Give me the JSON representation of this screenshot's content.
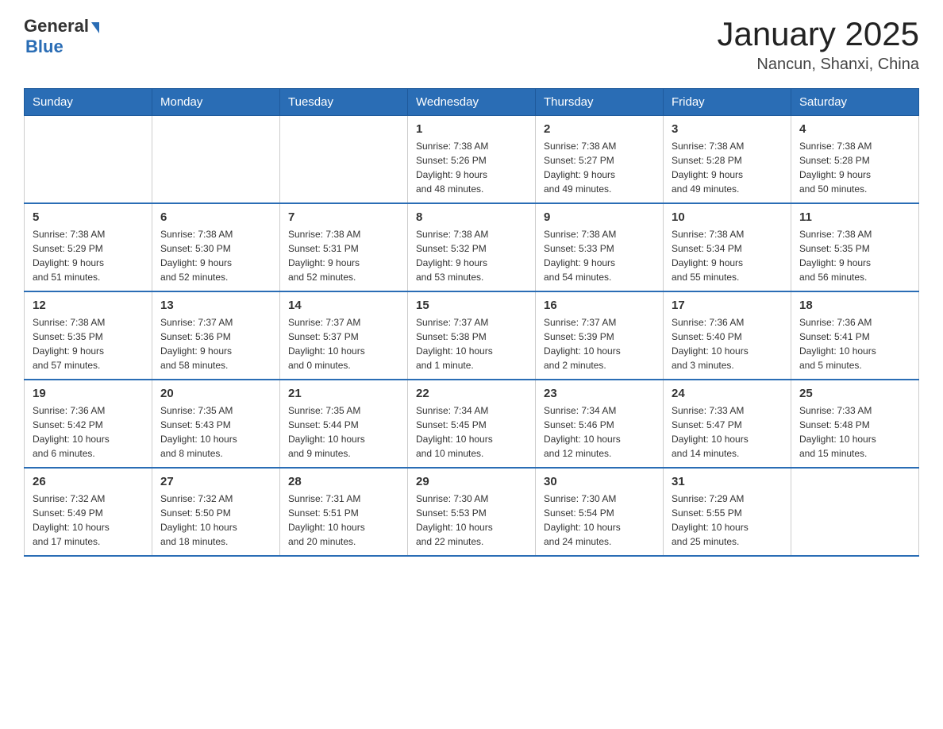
{
  "header": {
    "logo_general": "General",
    "logo_blue": "Blue",
    "month_title": "January 2025",
    "location": "Nancun, Shanxi, China"
  },
  "weekdays": [
    "Sunday",
    "Monday",
    "Tuesday",
    "Wednesday",
    "Thursday",
    "Friday",
    "Saturday"
  ],
  "weeks": [
    [
      {
        "day": "",
        "info": ""
      },
      {
        "day": "",
        "info": ""
      },
      {
        "day": "",
        "info": ""
      },
      {
        "day": "1",
        "info": "Sunrise: 7:38 AM\nSunset: 5:26 PM\nDaylight: 9 hours\nand 48 minutes."
      },
      {
        "day": "2",
        "info": "Sunrise: 7:38 AM\nSunset: 5:27 PM\nDaylight: 9 hours\nand 49 minutes."
      },
      {
        "day": "3",
        "info": "Sunrise: 7:38 AM\nSunset: 5:28 PM\nDaylight: 9 hours\nand 49 minutes."
      },
      {
        "day": "4",
        "info": "Sunrise: 7:38 AM\nSunset: 5:28 PM\nDaylight: 9 hours\nand 50 minutes."
      }
    ],
    [
      {
        "day": "5",
        "info": "Sunrise: 7:38 AM\nSunset: 5:29 PM\nDaylight: 9 hours\nand 51 minutes."
      },
      {
        "day": "6",
        "info": "Sunrise: 7:38 AM\nSunset: 5:30 PM\nDaylight: 9 hours\nand 52 minutes."
      },
      {
        "day": "7",
        "info": "Sunrise: 7:38 AM\nSunset: 5:31 PM\nDaylight: 9 hours\nand 52 minutes."
      },
      {
        "day": "8",
        "info": "Sunrise: 7:38 AM\nSunset: 5:32 PM\nDaylight: 9 hours\nand 53 minutes."
      },
      {
        "day": "9",
        "info": "Sunrise: 7:38 AM\nSunset: 5:33 PM\nDaylight: 9 hours\nand 54 minutes."
      },
      {
        "day": "10",
        "info": "Sunrise: 7:38 AM\nSunset: 5:34 PM\nDaylight: 9 hours\nand 55 minutes."
      },
      {
        "day": "11",
        "info": "Sunrise: 7:38 AM\nSunset: 5:35 PM\nDaylight: 9 hours\nand 56 minutes."
      }
    ],
    [
      {
        "day": "12",
        "info": "Sunrise: 7:38 AM\nSunset: 5:35 PM\nDaylight: 9 hours\nand 57 minutes."
      },
      {
        "day": "13",
        "info": "Sunrise: 7:37 AM\nSunset: 5:36 PM\nDaylight: 9 hours\nand 58 minutes."
      },
      {
        "day": "14",
        "info": "Sunrise: 7:37 AM\nSunset: 5:37 PM\nDaylight: 10 hours\nand 0 minutes."
      },
      {
        "day": "15",
        "info": "Sunrise: 7:37 AM\nSunset: 5:38 PM\nDaylight: 10 hours\nand 1 minute."
      },
      {
        "day": "16",
        "info": "Sunrise: 7:37 AM\nSunset: 5:39 PM\nDaylight: 10 hours\nand 2 minutes."
      },
      {
        "day": "17",
        "info": "Sunrise: 7:36 AM\nSunset: 5:40 PM\nDaylight: 10 hours\nand 3 minutes."
      },
      {
        "day": "18",
        "info": "Sunrise: 7:36 AM\nSunset: 5:41 PM\nDaylight: 10 hours\nand 5 minutes."
      }
    ],
    [
      {
        "day": "19",
        "info": "Sunrise: 7:36 AM\nSunset: 5:42 PM\nDaylight: 10 hours\nand 6 minutes."
      },
      {
        "day": "20",
        "info": "Sunrise: 7:35 AM\nSunset: 5:43 PM\nDaylight: 10 hours\nand 8 minutes."
      },
      {
        "day": "21",
        "info": "Sunrise: 7:35 AM\nSunset: 5:44 PM\nDaylight: 10 hours\nand 9 minutes."
      },
      {
        "day": "22",
        "info": "Sunrise: 7:34 AM\nSunset: 5:45 PM\nDaylight: 10 hours\nand 10 minutes."
      },
      {
        "day": "23",
        "info": "Sunrise: 7:34 AM\nSunset: 5:46 PM\nDaylight: 10 hours\nand 12 minutes."
      },
      {
        "day": "24",
        "info": "Sunrise: 7:33 AM\nSunset: 5:47 PM\nDaylight: 10 hours\nand 14 minutes."
      },
      {
        "day": "25",
        "info": "Sunrise: 7:33 AM\nSunset: 5:48 PM\nDaylight: 10 hours\nand 15 minutes."
      }
    ],
    [
      {
        "day": "26",
        "info": "Sunrise: 7:32 AM\nSunset: 5:49 PM\nDaylight: 10 hours\nand 17 minutes."
      },
      {
        "day": "27",
        "info": "Sunrise: 7:32 AM\nSunset: 5:50 PM\nDaylight: 10 hours\nand 18 minutes."
      },
      {
        "day": "28",
        "info": "Sunrise: 7:31 AM\nSunset: 5:51 PM\nDaylight: 10 hours\nand 20 minutes."
      },
      {
        "day": "29",
        "info": "Sunrise: 7:30 AM\nSunset: 5:53 PM\nDaylight: 10 hours\nand 22 minutes."
      },
      {
        "day": "30",
        "info": "Sunrise: 7:30 AM\nSunset: 5:54 PM\nDaylight: 10 hours\nand 24 minutes."
      },
      {
        "day": "31",
        "info": "Sunrise: 7:29 AM\nSunset: 5:55 PM\nDaylight: 10 hours\nand 25 minutes."
      },
      {
        "day": "",
        "info": ""
      }
    ]
  ]
}
